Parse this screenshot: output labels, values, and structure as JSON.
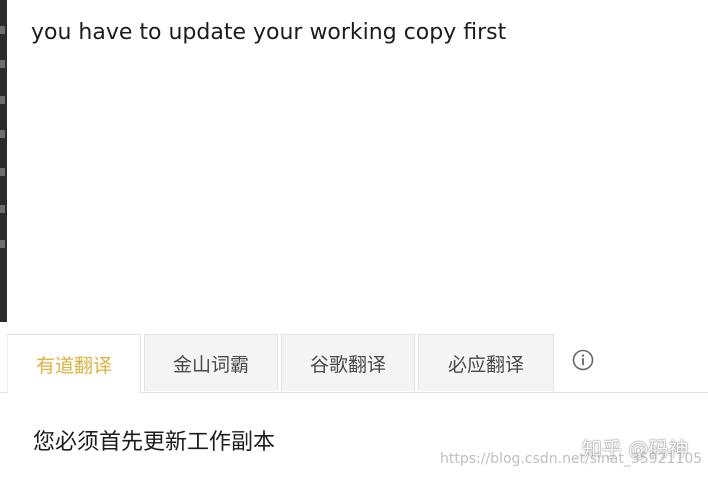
{
  "source_text": "you have to update your working copy first",
  "tabs": [
    {
      "label": "有道翻译",
      "active": true
    },
    {
      "label": "金山词霸",
      "active": false
    },
    {
      "label": "谷歌翻译",
      "active": false
    },
    {
      "label": "必应翻译",
      "active": false
    }
  ],
  "info_icon": "info-circle-icon",
  "result_text": "您必须首先更新工作副本",
  "watermarks": {
    "zhihu": "知乎 @码神",
    "csdn": "https://blog.csdn.net/sinat_35921105"
  },
  "colors": {
    "active_tab_text": "#e0b23c",
    "inactive_tab_text": "#4a4a4a",
    "inactive_tab_bg": "#f4f4f4",
    "text": "#1c1c1c"
  }
}
